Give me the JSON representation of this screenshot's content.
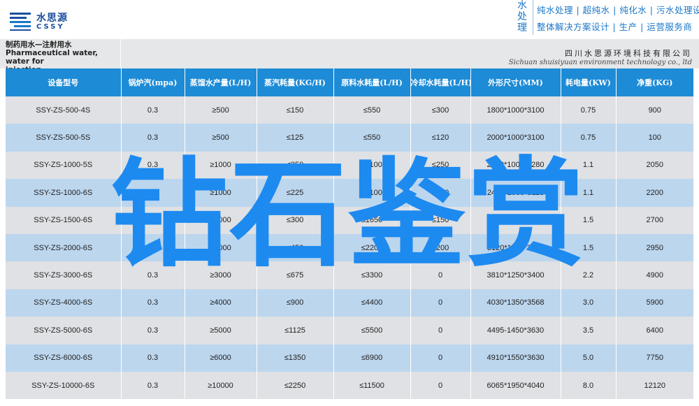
{
  "header": {
    "logo_cn": "水思源",
    "logo_en": "CSSY",
    "brand_vertical": "水处理",
    "tagline_1": "纯水处理 | 超纯水 | 纯化水 | 污水处理设备",
    "tagline_2": "整体解决方案设计 | 生产 | 运营服务商"
  },
  "title_band": {
    "title_cn": "制药用水—注射用水",
    "title_en_line1": "Pharmaceutical water, water for",
    "title_en_line2": "injection",
    "company_cn": "四川水思源环境科技有限公司",
    "company_en": "Sichuan shuisiyuan environment technology co., ltd"
  },
  "table": {
    "headers": [
      "设备型号",
      "锅炉汽(mpa)",
      "蒸馏水产量(L/H)",
      "蒸汽耗量(KG/H)",
      "原料水耗量(L/H)",
      "冷却水耗量(L/H)",
      "外形尺寸(MM)",
      "耗电量(KW)",
      "净重(KG)"
    ],
    "rows": [
      [
        "SSY-ZS-500-4S",
        "0.3",
        "≥500",
        "≤150",
        "≤550",
        "≤300",
        "1800*1000*3100",
        "0.75",
        "900"
      ],
      [
        "SSY-ZS-500-5S",
        "0.3",
        "≥500",
        "≤125",
        "≤550",
        "≤120",
        "2000*1000*3100",
        "0.75",
        "100"
      ],
      [
        "SSY-ZS-1000-5S",
        "0.3",
        "≥1000",
        "≤250",
        "≤1100",
        "≤250",
        "2200*1000*3280",
        "1.1",
        "2050"
      ],
      [
        "SSY-ZS-1000-6S",
        "0.3",
        "≥1000",
        "≤225",
        "≤1100",
        "≤100",
        "2450*1000*3118",
        "1.1",
        "2200"
      ],
      [
        "SSY-ZS-1500-6S",
        "0.3",
        "≥2000",
        "≤300",
        "≤1650",
        "≤150",
        "2450*1000*3400",
        "1.5",
        "2700"
      ],
      [
        "SSY-ZS-2000-6S",
        "0.3",
        "≥2000",
        "≤450",
        "≤2200",
        "≤200",
        "3120*1150*3400",
        "1.5",
        "2950"
      ],
      [
        "SSY-ZS-3000-6S",
        "0.3",
        "≥3000",
        "≤675",
        "≤3300",
        "0",
        "3810*1250*3400",
        "2.2",
        "4900"
      ],
      [
        "SSY-ZS-4000-6S",
        "0.3",
        "≥4000",
        "≤900",
        "≤4400",
        "0",
        "4030*1350*3568",
        "3.0",
        "5900"
      ],
      [
        "SSY-ZS-5000-6S",
        "0.3",
        "≥5000",
        "≤1125",
        "≤5500",
        "0",
        "4495-1450*3630",
        "3.5",
        "6400"
      ],
      [
        "SSY-ZS-6000-6S",
        "0.3",
        "≥6000",
        "≤1350",
        "≤6900",
        "0",
        "4910*1550*3630",
        "5.0",
        "7750"
      ],
      [
        "SSY-ZS-10000-6S",
        "0.3",
        "≥10000",
        "≤2250",
        "≤11500",
        "0",
        "6065*1950*4040",
        "8.0",
        "12120"
      ]
    ]
  },
  "watermark": "钻石鉴赏",
  "colors": {
    "header_blue": "#1d8bd6",
    "row_odd": "#dfe1e4",
    "row_even": "#bcd6ee",
    "watermark": "#1d8af0",
    "brand_blue": "#1b4f9c"
  }
}
